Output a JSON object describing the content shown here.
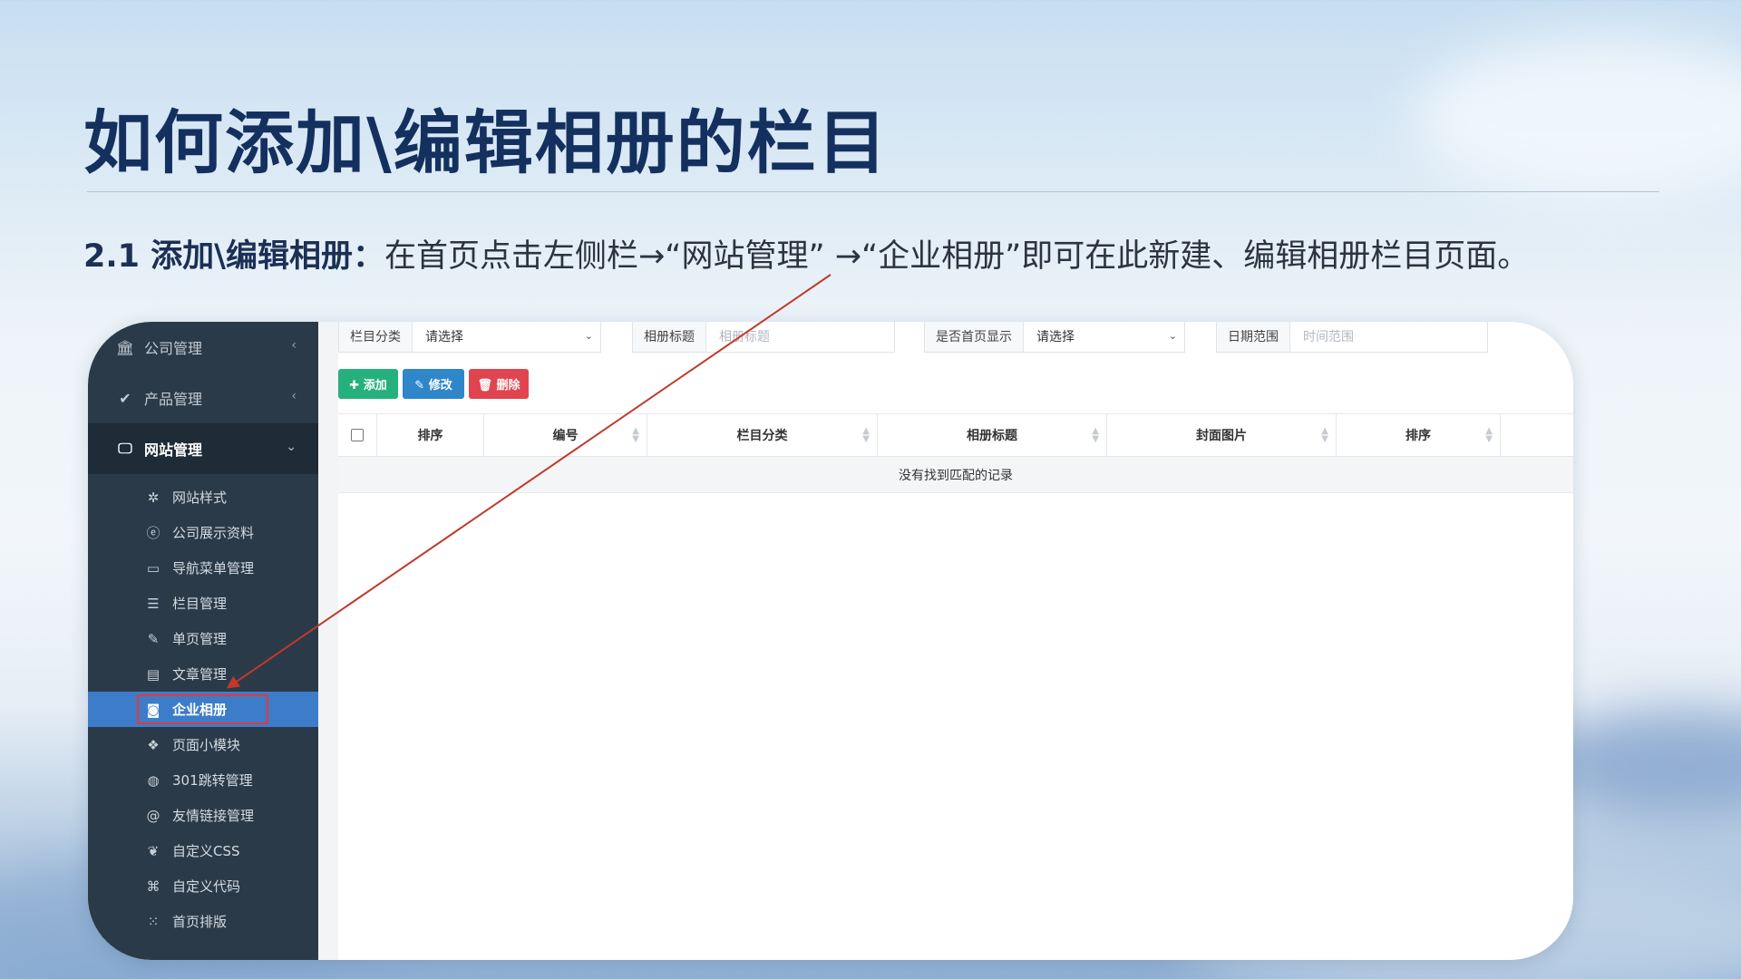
{
  "slide": {
    "title": "如何添加\\编辑相册的栏目",
    "subtitle_lead": "2.1  添加\\编辑相册：",
    "subtitle_desc": "在首页点击左侧栏→“网站管理” →“企业相册”即可在此新建、编辑相册栏目页面。"
  },
  "sidebar": {
    "top_items": [
      {
        "label": "公司管理",
        "icon": "bank-icon"
      },
      {
        "label": "产品管理",
        "icon": "wrench-icon"
      },
      {
        "label": "网站管理",
        "icon": "monitor-icon"
      }
    ],
    "sub_items": [
      {
        "label": "网站样式",
        "icon": "spinner-icon"
      },
      {
        "label": "公司展示资料",
        "icon": "ie-icon"
      },
      {
        "label": "导航菜单管理",
        "icon": "desktop-icon"
      },
      {
        "label": "栏目管理",
        "icon": "list-icon"
      },
      {
        "label": "单页管理",
        "icon": "edit-icon"
      },
      {
        "label": "文章管理",
        "icon": "newspaper-icon"
      },
      {
        "label": "企业相册",
        "icon": "camera-icon"
      },
      {
        "label": "页面小模块",
        "icon": "cubes-icon"
      },
      {
        "label": "301跳转管理",
        "icon": "globe-icon"
      },
      {
        "label": "友情链接管理",
        "icon": "at-icon"
      },
      {
        "label": "自定义CSS",
        "icon": "leaf-icon"
      },
      {
        "label": "自定义代码",
        "icon": "code-file-icon"
      },
      {
        "label": "首页排版",
        "icon": "grid-icon"
      }
    ],
    "active_item": "企业相册"
  },
  "filters": {
    "category_label": "栏目分类",
    "category_value": "请选择",
    "album_title_label": "相册标题",
    "album_title_placeholder": "相册标题",
    "homepage_label": "是否首页显示",
    "homepage_value": "请选择",
    "date_label": "日期范围",
    "date_placeholder": "时间范围"
  },
  "toolbar": {
    "add_label": "✚ 添加",
    "edit_label": "✎ 修改",
    "delete_label": "🗑 删除"
  },
  "table": {
    "columns": [
      "排序",
      "编号",
      "栏目分类",
      "相册标题",
      "封面图片",
      "排序"
    ],
    "empty_text": "没有找到匹配的记录"
  },
  "colors": {
    "title": "#14305f",
    "sidebar_bg": "#2b3a48",
    "active_item": "#3d7cc9",
    "add_button": "#26b07d",
    "edit_button": "#2f86c9",
    "delete_button": "#e0454f",
    "annotation": "#c0392b"
  }
}
